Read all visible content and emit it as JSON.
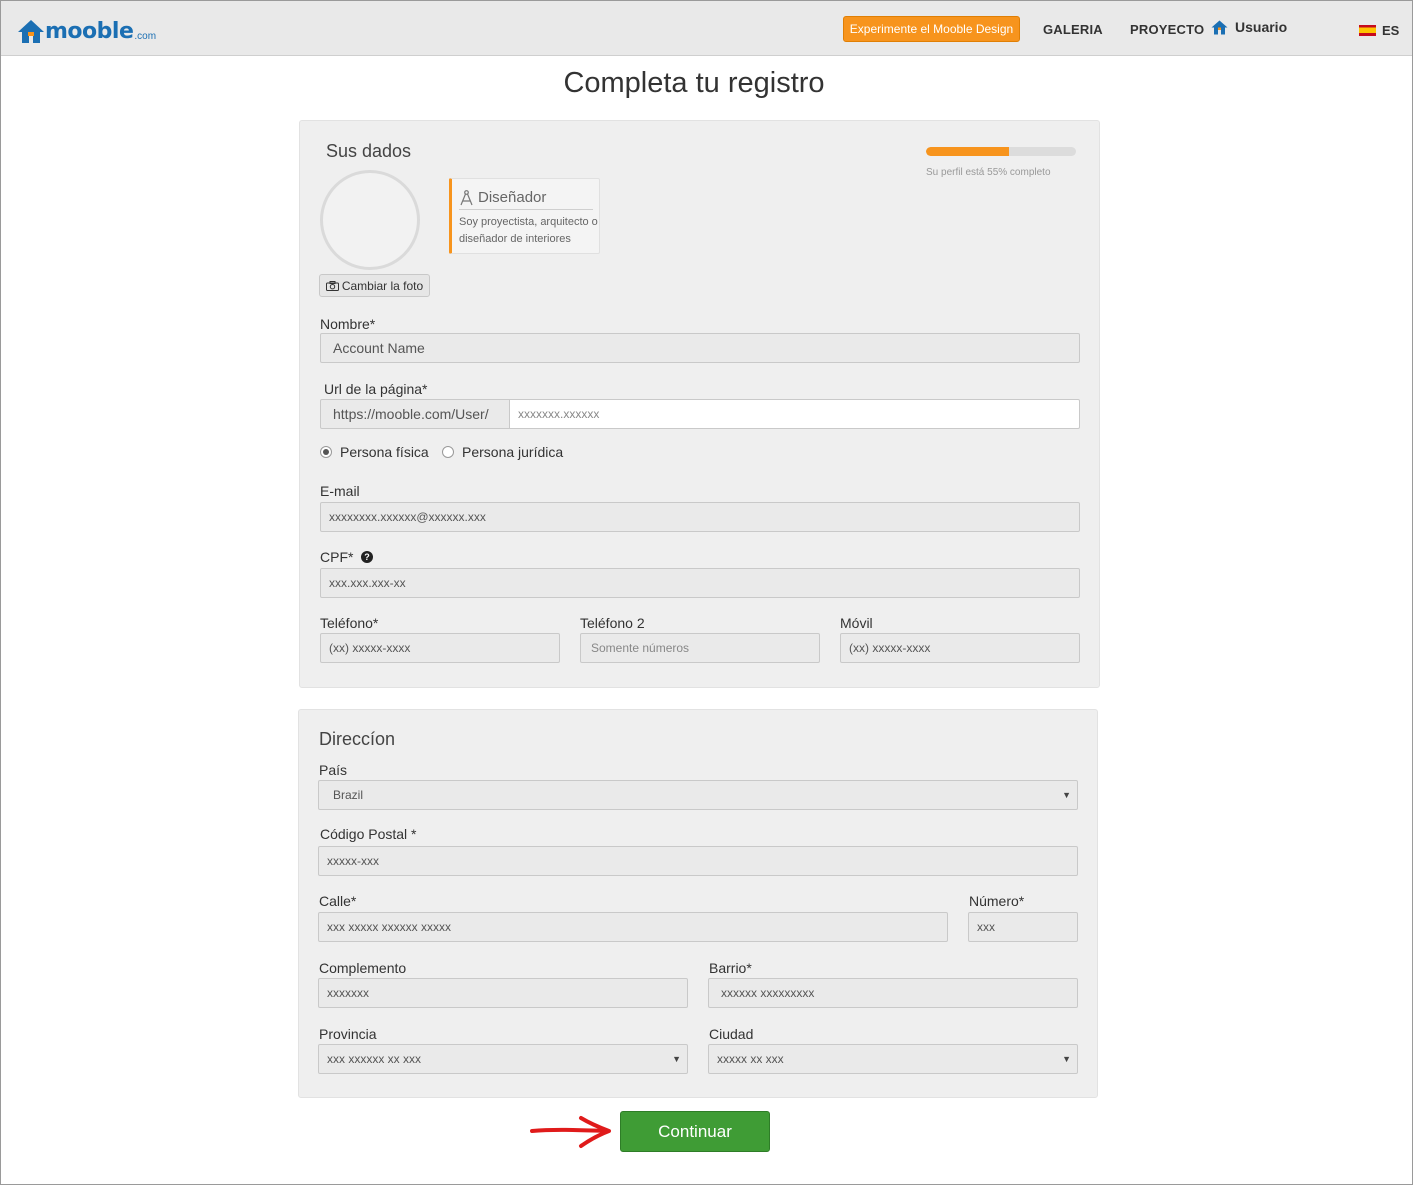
{
  "header": {
    "logo_text": "mooble",
    "logo_suffix": ".com",
    "cta_label": "Experimente el Mooble Design",
    "nav_galeria": "GALERIA",
    "nav_proyecto": "PROYECTO",
    "nav_user": "Usuario",
    "lang": "ES"
  },
  "page_title": "Completa tu registro",
  "profile": {
    "section_title": "Sus dados",
    "progress_percent": 55,
    "progress_text": "Su perfil está 55% completo",
    "change_photo_label": "Cambiar la foto",
    "role_title": "Diseñador",
    "role_desc": "Soy proyectista, arquitecto o diseñador de interiores",
    "name_label": "Nombre*",
    "name_value": "Account Name",
    "url_label": "Url de la página*",
    "url_prefix": "https://mooble.com/User/",
    "url_placeholder": "xxxxxxx.xxxxxx",
    "radio_fisica": "Persona física",
    "radio_juridica": "Persona jurídica",
    "email_label": "E-mail",
    "email_value": "xxxxxxxx.xxxxxx@xxxxxx.xxx",
    "cpf_label": "CPF*",
    "cpf_placeholder": "xxx.xxx.xxx-xx",
    "telefono_label": "Teléfono*",
    "telefono_placeholder": "(xx) xxxxx-xxxx",
    "telefono2_label": "Teléfono 2",
    "telefono2_placeholder": "Somente números",
    "movil_label": "Móvil",
    "movil_placeholder": "(xx) xxxxx-xxxx"
  },
  "address": {
    "section_title": "Direccíon",
    "pais_label": "País",
    "pais_value": "Brazil",
    "cp_label": "Código Postal *",
    "cp_placeholder": "xxxxx-xxx",
    "calle_label": "Calle*",
    "calle_value": "xxx xxxxx xxxxxx xxxxx",
    "numero_label": "Número*",
    "numero_value": "xxx",
    "complemento_label": "Complemento",
    "complemento_value": "xxxxxxx",
    "barrio_label": "Barrio*",
    "barrio_value": "xxxxxx xxxxxxxxx",
    "provincia_label": "Provincia",
    "provincia_value": "xxx xxxxxx xx xxx",
    "ciudad_label": "Ciudad",
    "ciudad_value": "xxxxx xx xxx"
  },
  "continue_label": "Continuar",
  "colors": {
    "accent": "#f7941d",
    "brand": "#1b6fb3",
    "success": "#3f9c35",
    "arrow": "#e01b1b"
  }
}
